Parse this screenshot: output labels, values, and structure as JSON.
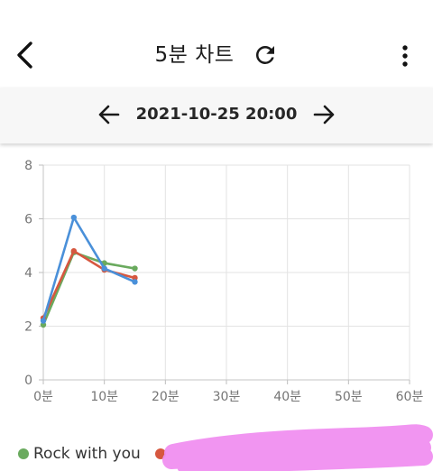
{
  "header": {
    "title": "5분 차트",
    "back_icon": "chevron-left-icon",
    "refresh_icon": "refresh-icon",
    "more_icon": "more-vert-icon"
  },
  "date_nav": {
    "prev_icon": "arrow-left-icon",
    "datetime": "2021-10-25 20:00",
    "next_icon": "arrow-right-icon"
  },
  "chart_data": {
    "type": "line",
    "title": "",
    "xlabel": "",
    "ylabel": "",
    "xlim": [
      0,
      60
    ],
    "ylim": [
      0,
      8
    ],
    "x_ticks": [
      0,
      10,
      20,
      30,
      40,
      50,
      60
    ],
    "x_tick_labels": [
      "0분",
      "10분",
      "20분",
      "30분",
      "40분",
      "50분",
      "60분"
    ],
    "y_ticks": [
      0,
      2,
      4,
      6,
      8
    ],
    "y_tick_labels": [
      "0",
      "2",
      "4",
      "6",
      "8"
    ],
    "grid": true,
    "legend_position": "bottom",
    "series": [
      {
        "name": "Rock with you",
        "color": "#6aaa5e",
        "x": [
          0,
          5,
          10,
          15
        ],
        "y": [
          2.05,
          4.75,
          4.35,
          4.15
        ]
      },
      {
        "name": "",
        "color": "#d6573f",
        "x": [
          0,
          5,
          10,
          15
        ],
        "y": [
          2.3,
          4.8,
          4.1,
          3.8
        ]
      },
      {
        "name": "",
        "color": "#4a90d9",
        "x": [
          0,
          5,
          10,
          15
        ],
        "y": [
          2.2,
          6.05,
          4.15,
          3.65
        ]
      }
    ]
  },
  "legend": {
    "items": [
      {
        "label": "Rock with you",
        "color": "#6aaa5e"
      },
      {
        "label": "",
        "color": "#d6573f"
      }
    ]
  },
  "colors": {
    "redaction": "#f08ff0"
  }
}
